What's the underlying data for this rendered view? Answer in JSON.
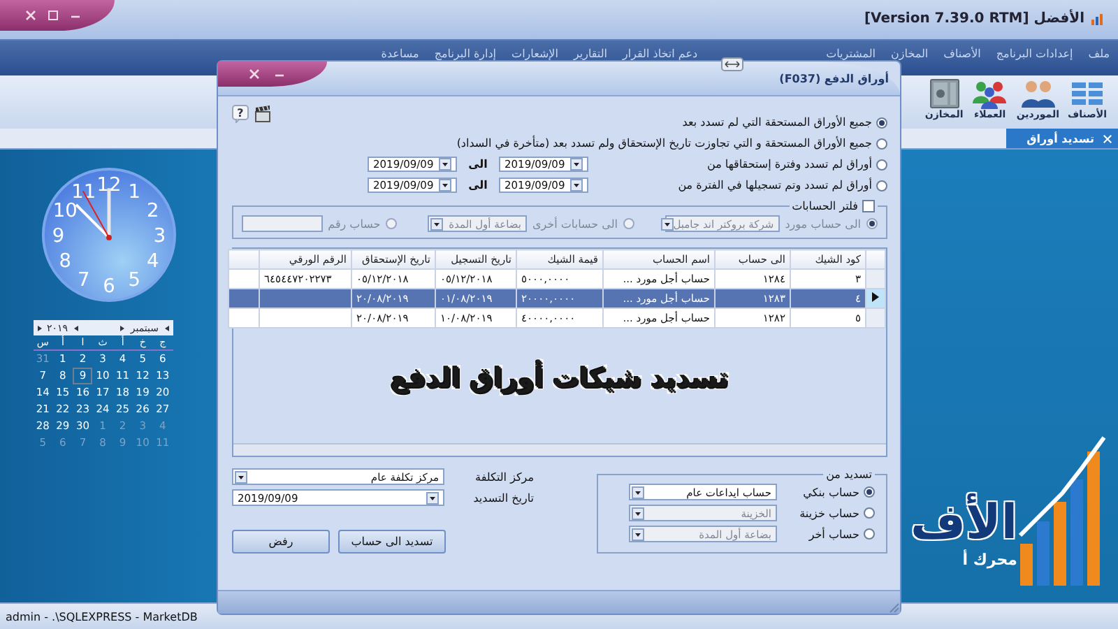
{
  "app": {
    "title": "[Version 7.39.0 RTM] الأفضل"
  },
  "menu": [
    {
      "label": "ملف"
    },
    {
      "label": "إعدادات البرنامج"
    },
    {
      "label": "الأصناف"
    },
    {
      "label": "المخازن"
    },
    {
      "label": "المشتريات"
    },
    {
      "label": "دعم اتخاذ القرار"
    },
    {
      "label": "التقارير"
    },
    {
      "label": "الإشعارات"
    },
    {
      "label": "إدارة البرنامج"
    },
    {
      "label": "مساعدة"
    }
  ],
  "toolbar": [
    {
      "label": "الأصناف",
      "kind": "grid"
    },
    {
      "label": "الموردين",
      "kind": "people"
    },
    {
      "label": "العملاء",
      "kind": "group"
    },
    {
      "label": "المخازن",
      "kind": "safe"
    }
  ],
  "tabs": [
    {
      "label": "تسديد أوراق",
      "selected": true
    }
  ],
  "clock": {
    "numerals": [
      "12",
      "1",
      "11",
      "2",
      "10",
      "3",
      "9",
      "4",
      "8",
      "5",
      "7",
      "6"
    ]
  },
  "calendar": {
    "month": "سبتمبر",
    "year": "٢٠١٩",
    "weekdays": [
      "ج",
      "خ",
      "أ",
      "ث",
      "ا",
      "أ",
      "س"
    ],
    "weeks": [
      [
        {
          "day": "6",
          "muted": false,
          "selected": false
        },
        {
          "day": "5",
          "muted": false,
          "selected": false
        },
        {
          "day": "4",
          "muted": false,
          "selected": false
        },
        {
          "day": "3",
          "muted": false,
          "selected": false
        },
        {
          "day": "2",
          "muted": false,
          "selected": false
        },
        {
          "day": "1",
          "muted": false,
          "selected": false
        },
        {
          "day": "31",
          "muted": true,
          "selected": false
        }
      ],
      [
        {
          "day": "13",
          "muted": false,
          "selected": false
        },
        {
          "day": "12",
          "muted": false,
          "selected": false
        },
        {
          "day": "11",
          "muted": false,
          "selected": false
        },
        {
          "day": "10",
          "muted": false,
          "selected": false
        },
        {
          "day": "9",
          "muted": false,
          "selected": true
        },
        {
          "day": "8",
          "muted": false,
          "selected": false
        },
        {
          "day": "7",
          "muted": false,
          "selected": false
        }
      ],
      [
        {
          "day": "20",
          "muted": false,
          "selected": false
        },
        {
          "day": "19",
          "muted": false,
          "selected": false
        },
        {
          "day": "18",
          "muted": false,
          "selected": false
        },
        {
          "day": "17",
          "muted": false,
          "selected": false
        },
        {
          "day": "16",
          "muted": false,
          "selected": false
        },
        {
          "day": "15",
          "muted": false,
          "selected": false
        },
        {
          "day": "14",
          "muted": false,
          "selected": false
        }
      ],
      [
        {
          "day": "27",
          "muted": false,
          "selected": false
        },
        {
          "day": "26",
          "muted": false,
          "selected": false
        },
        {
          "day": "25",
          "muted": false,
          "selected": false
        },
        {
          "day": "24",
          "muted": false,
          "selected": false
        },
        {
          "day": "23",
          "muted": false,
          "selected": false
        },
        {
          "day": "22",
          "muted": false,
          "selected": false
        },
        {
          "day": "21",
          "muted": false,
          "selected": false
        }
      ],
      [
        {
          "day": "4",
          "muted": true,
          "selected": false
        },
        {
          "day": "3",
          "muted": true,
          "selected": false
        },
        {
          "day": "2",
          "muted": true,
          "selected": false
        },
        {
          "day": "1",
          "muted": true,
          "selected": false
        },
        {
          "day": "30",
          "muted": false,
          "selected": false
        },
        {
          "day": "29",
          "muted": false,
          "selected": false
        },
        {
          "day": "28",
          "muted": false,
          "selected": false
        }
      ],
      [
        {
          "day": "11",
          "muted": true,
          "selected": false
        },
        {
          "day": "10",
          "muted": true,
          "selected": false
        },
        {
          "day": "9",
          "muted": true,
          "selected": false
        },
        {
          "day": "8",
          "muted": true,
          "selected": false
        },
        {
          "day": "7",
          "muted": true,
          "selected": false
        },
        {
          "day": "6",
          "muted": true,
          "selected": false
        },
        {
          "day": "5",
          "muted": true,
          "selected": false
        }
      ]
    ]
  },
  "logo": {
    "text": "الأف",
    "tagline": "محرك أ"
  },
  "dialog": {
    "title": "أوراق الدفع (F037)",
    "help_icon": "?",
    "options": [
      {
        "label": "جميع الأوراق المستحقة التي لم تسدد بعد",
        "selected": true,
        "kind": "plain"
      },
      {
        "label": "جميع الأوراق المستحقة و التي تجاوزت تاريخ الإستحقاق ولم تسدد بعد (متأخرة في السداد)",
        "selected": false,
        "kind": "plain"
      },
      {
        "label": "أوراق لم تسدد وفترة إستحقاقها من",
        "selected": false,
        "kind": "range",
        "from": "2019/09/09",
        "to_label": "الى",
        "to": "2019/09/09"
      },
      {
        "label": "أوراق لم تسدد وتم تسجيلها في الفترة من",
        "selected": false,
        "kind": "range",
        "from": "2019/09/09",
        "to_label": "الى",
        "to": "2019/09/09"
      }
    ],
    "filter": {
      "label": "فلتر الحسابات",
      "checked": false,
      "options": [
        {
          "label": "الى حساب مورد",
          "selected": true,
          "kind": "combo",
          "value": "شركة بروكتر اند جامبل"
        },
        {
          "label": "الى حسابات أخرى",
          "selected": false,
          "kind": "combo",
          "value": "بضاعة أول المدة"
        },
        {
          "label": "حساب رقم",
          "selected": false,
          "kind": "input"
        }
      ]
    },
    "table": {
      "columns": [
        "كود الشيك",
        "الى حساب",
        "اسم الحساب",
        "قيمة الشيك",
        "تاريخ التسجيل",
        "تاريخ الإستحقاق",
        "الرقم الورقي"
      ],
      "rows": [
        {
          "selected": false,
          "cells": [
            "٣",
            "١٢٨٤",
            "حساب أجل مورد ...",
            "٥٠٠٠,٠٠٠٠",
            "٠٥/١٢/٢٠١٨",
            "٠٥/١٢/٢٠١٨",
            "٦٤٥٤٤٧٢٠٢٢٧٣"
          ]
        },
        {
          "selected": true,
          "cells": [
            "٤",
            "١٢٨٣",
            "حساب أجل مورد ...",
            "٢٠٠٠٠,٠٠٠٠",
            "٠١/٠٨/٢٠١٩",
            "٢٠/٠٨/٢٠١٩",
            ""
          ]
        },
        {
          "selected": false,
          "cells": [
            "٥",
            "١٢٨٢",
            "حساب أجل مورد ...",
            "٤٠٠٠٠,٠٠٠٠",
            "١٠/٠٨/٢٠١٩",
            "٢٠/٠٨/٢٠١٩",
            ""
          ]
        }
      ]
    },
    "caption": "تسديد شيكات أوراق الدفع",
    "pay_from": {
      "label": "تسديد من",
      "options": [
        {
          "label": "حساب بنكي",
          "selected": true,
          "value": "حساب ايداعات عام"
        },
        {
          "label": "حساب خزينة",
          "selected": false,
          "value": "الخزينة"
        },
        {
          "label": "حساب أخر",
          "selected": false,
          "value": "بضاعة أول المدة"
        }
      ]
    },
    "cost_center": {
      "label": "مركز التكلفة",
      "value": "مركز تكلفة عام"
    },
    "pay_date": {
      "label": "تاريخ التسديد",
      "value": "2019/09/09"
    },
    "buttons": [
      "تسديد الى حساب",
      "رفض"
    ]
  },
  "status_bar": "admin - .\\SQLEXPRESS - MarketDB"
}
